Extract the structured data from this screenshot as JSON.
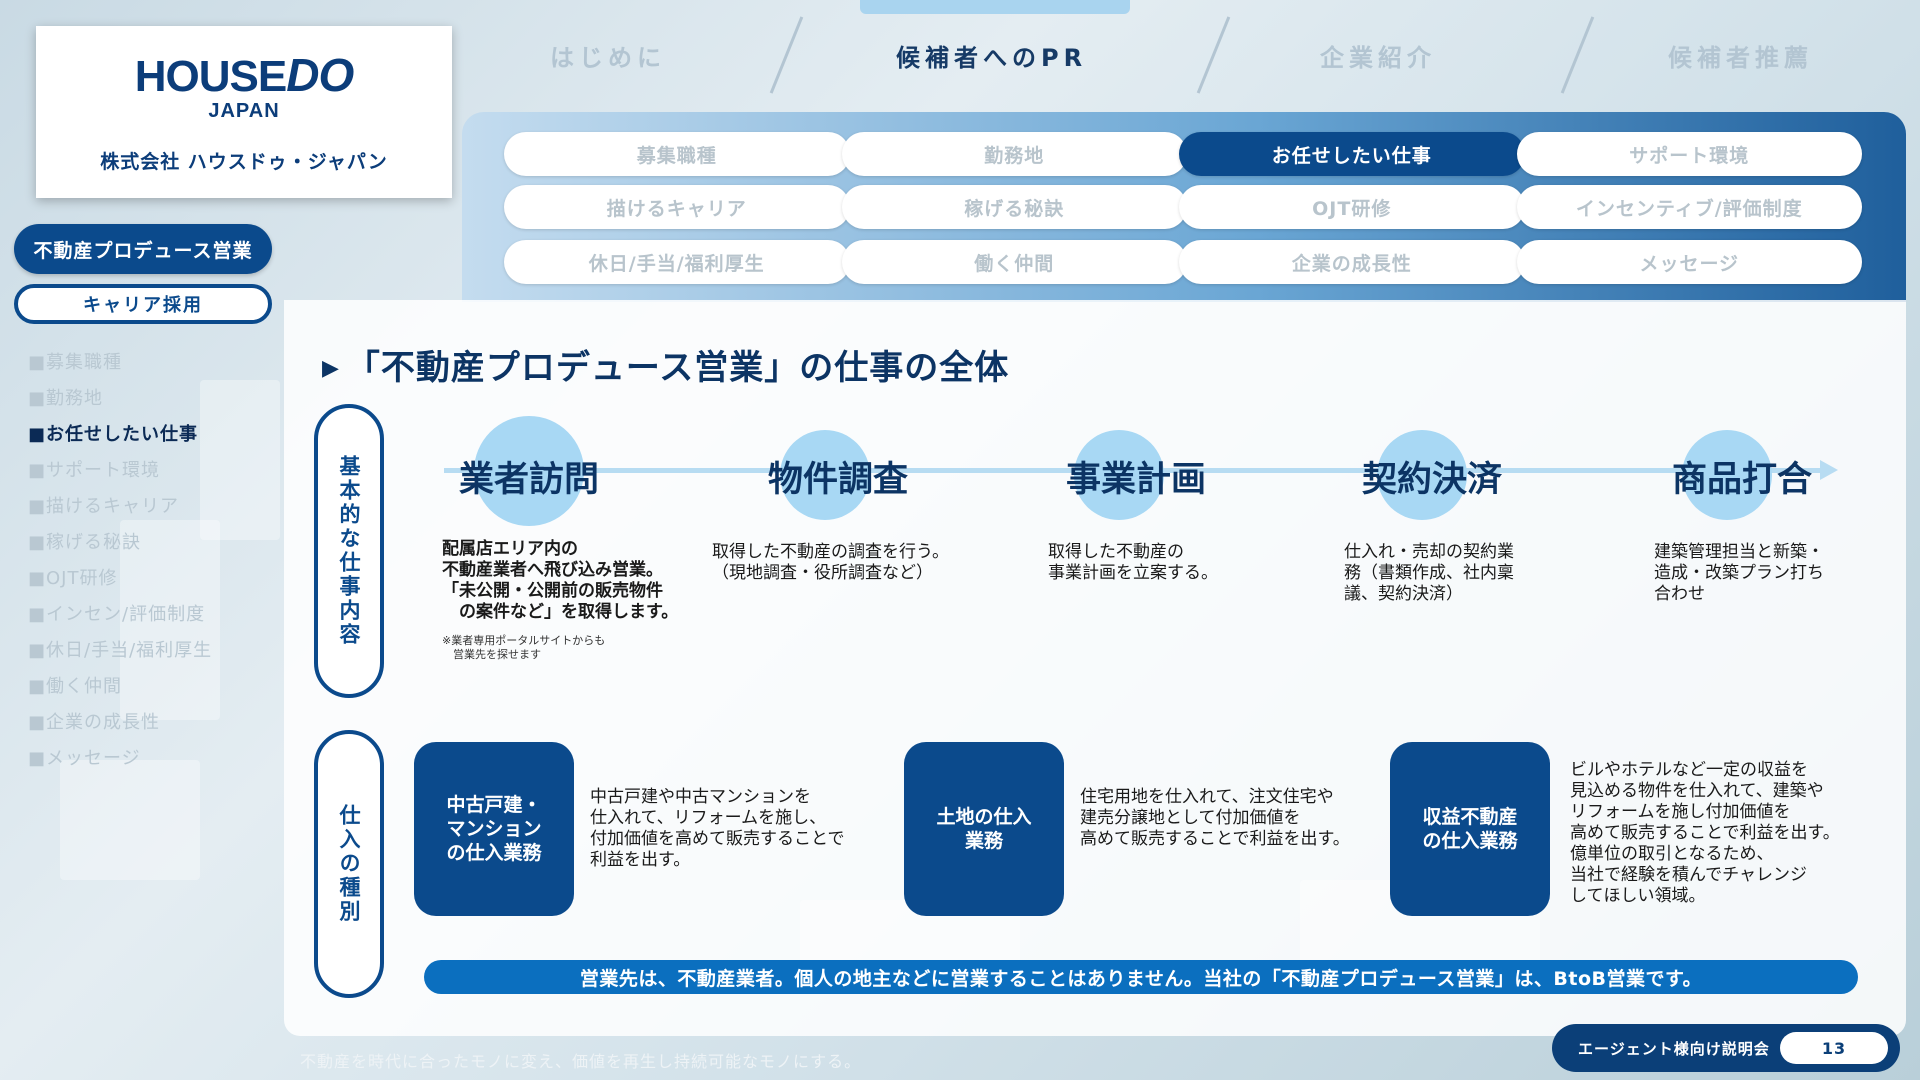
{
  "logo": {
    "brand_main": "HOUSE",
    "brand_do": "DO",
    "brand_sub": "JAPAN",
    "company": "株式会社 ハウスドゥ・ジャパン"
  },
  "sidebar": {
    "primary_label": "不動産プロデュース営業",
    "secondary_label": "キャリア採用",
    "items": [
      {
        "label": "■募集職種"
      },
      {
        "label": "■勤務地"
      },
      {
        "label": "■お任せしたい仕事"
      },
      {
        "label": "■サポート環境"
      },
      {
        "label": "■描けるキャリア"
      },
      {
        "label": "■稼げる秘訣"
      },
      {
        "label": "■OJT研修"
      },
      {
        "label": "■インセン/評価制度"
      },
      {
        "label": "■休日/手当/福利厚生"
      },
      {
        "label": "■働く仲間"
      },
      {
        "label": "■企業の成長性"
      },
      {
        "label": "■メッセージ"
      }
    ],
    "active_index": 2
  },
  "top_nav": {
    "items": [
      {
        "label": "はじめに"
      },
      {
        "label": "候補者へのPR"
      },
      {
        "label": "企業紹介"
      },
      {
        "label": "候補者推薦"
      }
    ],
    "active_index": 1
  },
  "tabs": {
    "rows": [
      [
        {
          "label": "募集職種"
        },
        {
          "label": "勤務地"
        },
        {
          "label": "お任せしたい仕事"
        },
        {
          "label": "サポート環境"
        }
      ],
      [
        {
          "label": "描けるキャリア"
        },
        {
          "label": "稼げる秘訣"
        },
        {
          "label": "OJT研修"
        },
        {
          "label": "インセンティブ/評価制度"
        }
      ],
      [
        {
          "label": "休日/手当/福利厚生"
        },
        {
          "label": "働く仲間"
        },
        {
          "label": "企業の成長性"
        },
        {
          "label": "メッセージ"
        }
      ]
    ],
    "active": "お任せしたい仕事"
  },
  "main": {
    "title_marker": "▶",
    "title": "「不動産プロデュース営業」の仕事の全体",
    "label_work": "基本的な仕事内容",
    "label_types": "仕入の種別",
    "steps": [
      {
        "title": "業者訪問",
        "desc": "配属店エリア内の\n不動産業者へ飛び込み営業。\n「未公開・公開前の販売物件\n　の案件など」を取得します。",
        "note": "※業者専用ポータルサイトからも\n　営業先を探せます"
      },
      {
        "title": "物件調査",
        "desc": "取得した不動産の調査を行う。\n（現地調査・役所調査など）"
      },
      {
        "title": "事業計画",
        "desc": "取得した不動産の\n事業計画を立案する。"
      },
      {
        "title": "契約決済",
        "desc": "仕入れ・売却の契約業\n務（書類作成、社内稟\n議、契約決済）"
      },
      {
        "title": "商品打合",
        "desc": "建築管理担当と新築・\n造成・改築プラン打ち\n合わせ"
      }
    ],
    "types": [
      {
        "label": "中古戸建・\nマンション\nの仕入業務",
        "desc": "中古戸建や中古マンションを\n仕入れて、リフォームを施し、\n付加価値を高めて販売することで\n利益を出す。"
      },
      {
        "label": "土地の仕入\n業務",
        "desc": "住宅用地を仕入れて、注文住宅や\n建売分譲地として付加価値を\n高めて販売することで利益を出す。"
      },
      {
        "label": "収益不動産\nの仕入業務",
        "desc": "ビルやホテルなど一定の収益を\n見込める物件を仕入れて、建築や\nリフォームを施し付加価値を\n高めて販売することで利益を出す。\n億単位の取引となるため、\n当社で経験を積んでチャレンジ\nしてほしい領域。"
      }
    ],
    "bottom_message": "営業先は、不動産業者。個人の地主などに営業することはありません。当社の「不動産プロデュース営業」は、BtoB営業です。"
  },
  "footer": {
    "slogan": "不動産を時代に合ったモノに変え、価値を再生し持続可能なモノにする。",
    "badge_label": "エージェント様向け説明会",
    "page_number": "13"
  },
  "colors": {
    "brand_navy": "#0b4a8c",
    "accent_light_blue": "#a8d8f4",
    "bottom_bar": "#0b6fbf"
  }
}
